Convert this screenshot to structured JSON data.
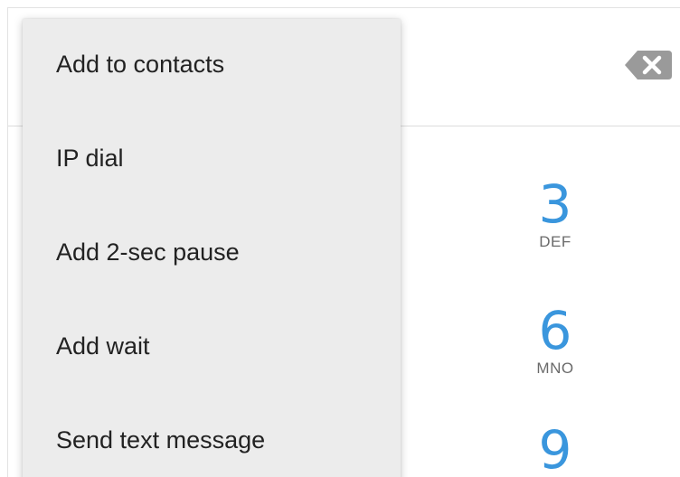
{
  "menu": {
    "items": [
      {
        "label": "Add to contacts"
      },
      {
        "label": "IP dial"
      },
      {
        "label": "Add 2-sec pause"
      },
      {
        "label": "Add wait"
      },
      {
        "label": "Send text message"
      }
    ]
  },
  "keypad": {
    "keys": [
      {
        "digit": "3",
        "letters": "DEF"
      },
      {
        "digit": "6",
        "letters": "MNO"
      },
      {
        "digit": "9",
        "letters": ""
      }
    ]
  },
  "icons": {
    "backspace": "backspace-icon"
  },
  "colors": {
    "digit_accent": "#3a96dd",
    "menu_background": "#ececec",
    "backspace_icon": "#9a9a9a"
  }
}
